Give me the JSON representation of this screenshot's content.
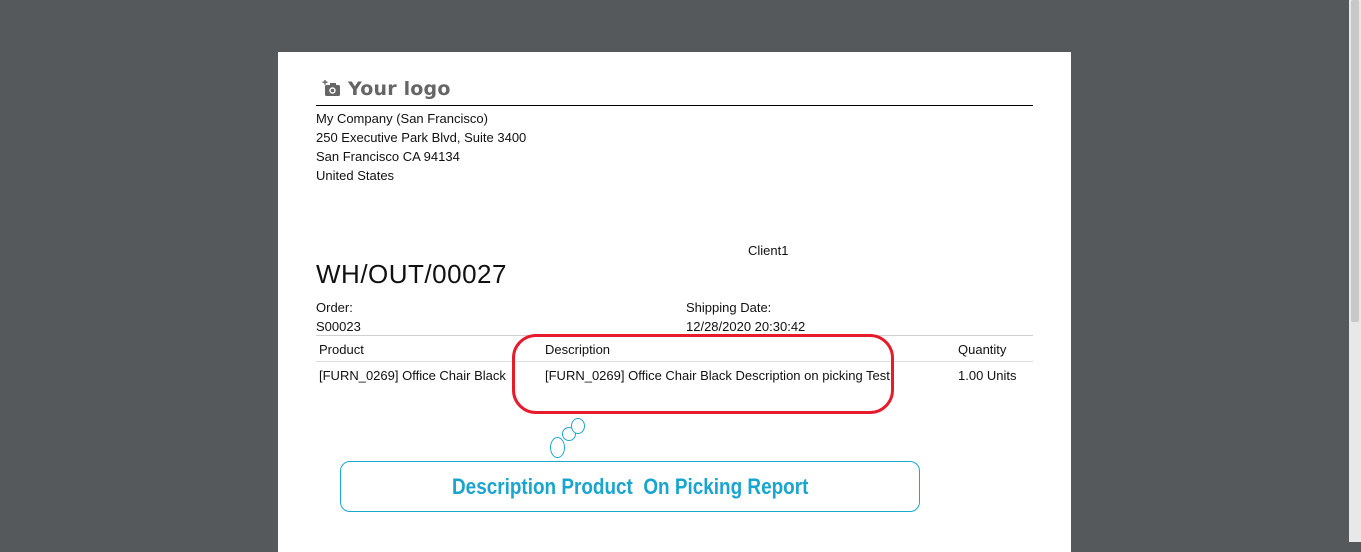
{
  "logo": {
    "icon": "camera-icon",
    "text": "Your logo"
  },
  "company": {
    "name": "My Company (San Francisco)",
    "street": "250 Executive Park Blvd, Suite 3400",
    "city": "San Francisco CA 94134",
    "country": "United States"
  },
  "client": "Client1",
  "document": {
    "title": "WH/OUT/00027"
  },
  "order": {
    "label": "Order:",
    "value": "S00023"
  },
  "shipping": {
    "label": "Shipping Date:",
    "value": "12/28/2020 20:30:42"
  },
  "table": {
    "headers": {
      "product": "Product",
      "description": "Description",
      "quantity": "Quantity"
    },
    "rows": [
      {
        "product": "[FURN_0269] Office Chair Black",
        "description": "[FURN_0269] Office Chair Black Description on picking Test",
        "quantity": "1.00 Units"
      }
    ]
  },
  "annotation": {
    "text": "Description Product  On Picking Report",
    "highlight_color": "#e61b2c",
    "callout_color": "#1aa4d0"
  },
  "colors": {
    "viewer_bg": "#55595c",
    "page_bg": "#ffffff"
  }
}
